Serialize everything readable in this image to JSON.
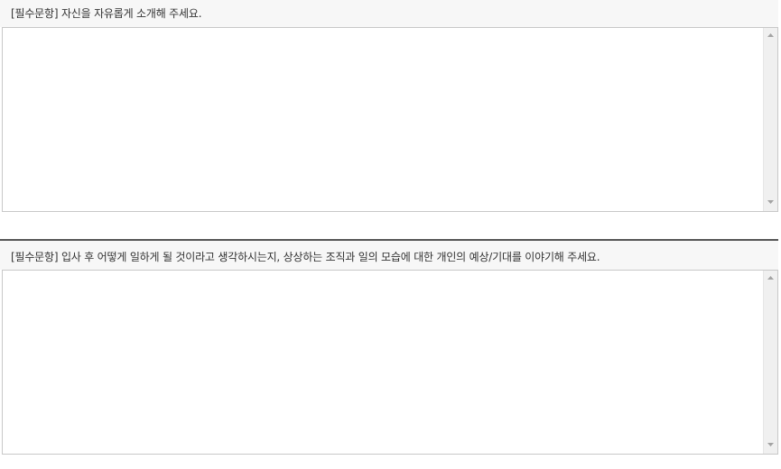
{
  "questions": [
    {
      "label": "[필수문항] 자신을 자유롭게 소개해 주세요.",
      "value": ""
    },
    {
      "label": "[필수문항] 입사 후 어떻게 일하게 될 것이라고 생각하시는지, 상상하는 조직과 일의 모습에 대한 개인의 예상/기대를 이야기해 주세요.",
      "value": ""
    }
  ],
  "icons": {
    "scroll_up": "triangle-up-icon",
    "scroll_down": "triangle-down-icon"
  },
  "colors": {
    "header_bg": "#f7f7f7",
    "border": "#c8c8c8",
    "divider": "#555555",
    "text": "#333333"
  }
}
